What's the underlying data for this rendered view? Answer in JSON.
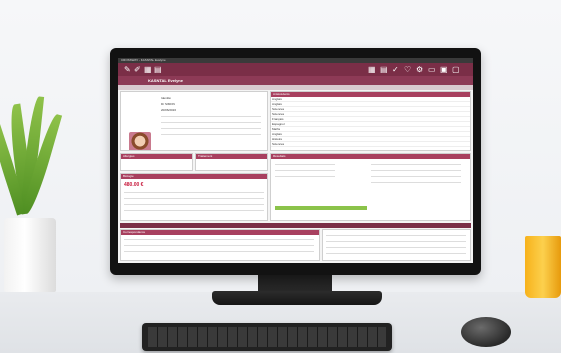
{
  "app": {
    "window_title": "CROSSWAY - KASNTAL Evelyne",
    "patient_label": "KASNTAL Evelyne",
    "toolbar_icons": [
      "pen-icon",
      "pencil-icon",
      "calendar-icon",
      "document-icon",
      "grid-icon",
      "checkmark-icon",
      "heart-icon",
      "settings-icon",
      "folder-icon",
      "window-icon"
    ],
    "section_titles": {
      "history": "Antécédents",
      "allergies": "Allergies",
      "treatment": "Traitement",
      "results": "Résultats",
      "biology": "Biologie",
      "correspondence": "Correspondance"
    },
    "amount": "480.00 €",
    "fields": {
      "doctor": "Dr SIMON",
      "identity": "Identité",
      "date": "20/06/2016"
    },
    "list_rows": [
      "Anglais",
      "Anglais",
      "Sciences",
      "Sciences",
      "Français",
      "Espagnol",
      "Maths",
      "Anglais",
      "Histoire",
      "Sciences"
    ]
  },
  "colors": {
    "accent": "#7a2e47",
    "accent_light": "#a8405f",
    "alert_red": "#c8193c",
    "screen_bg": "#f4f4f4"
  }
}
